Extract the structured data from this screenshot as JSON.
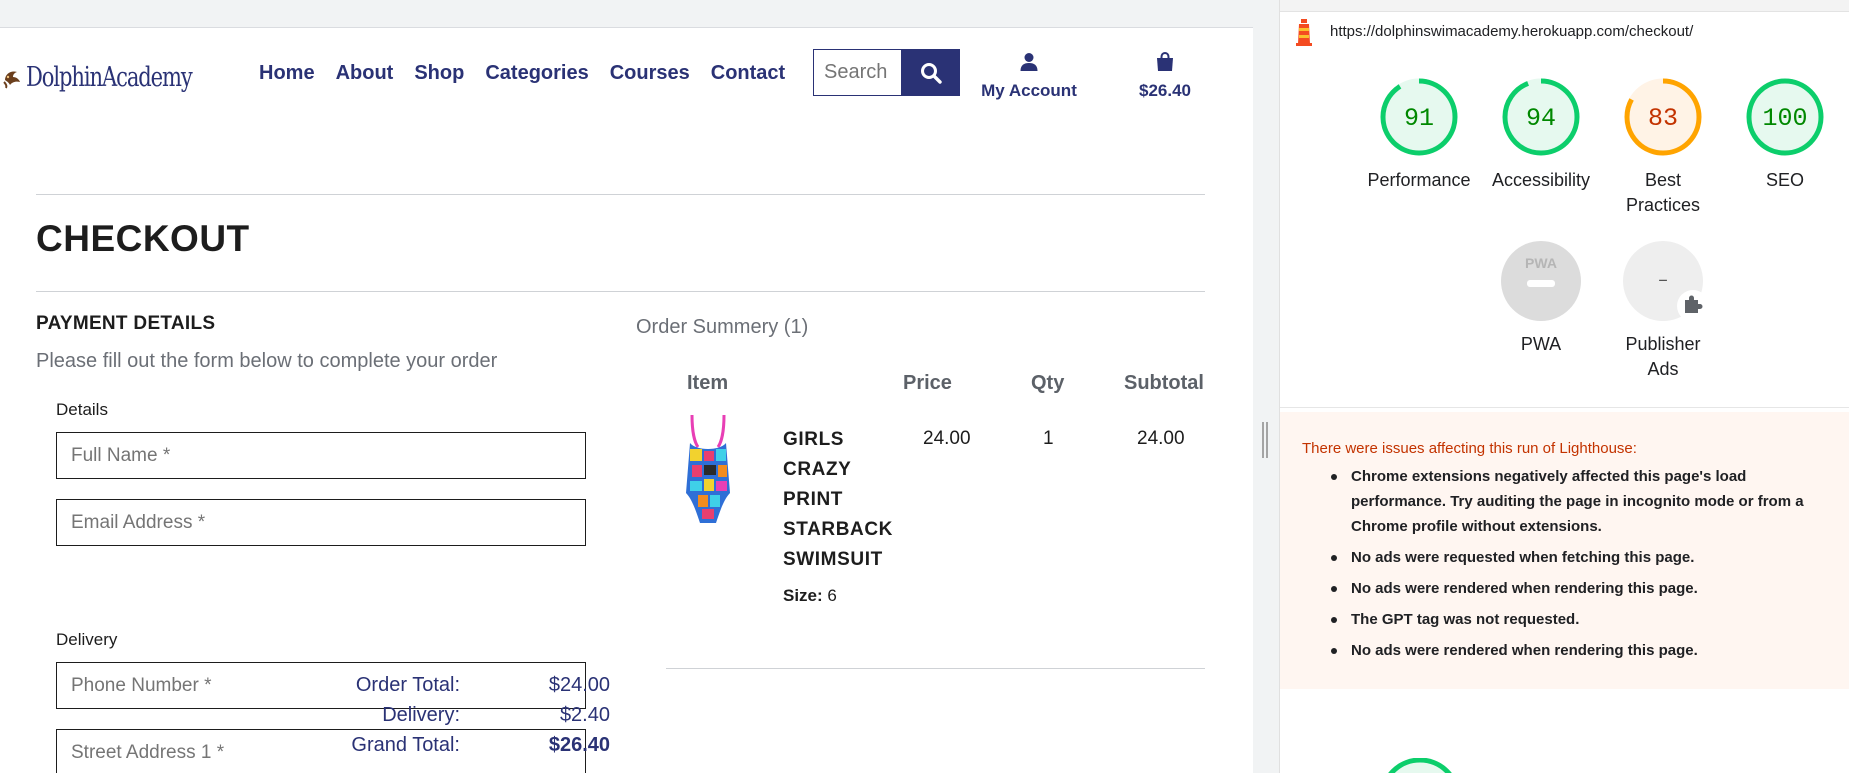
{
  "site": {
    "logo_text": "DolphinAcademy",
    "nav": [
      "Home",
      "About",
      "Shop",
      "Categories",
      "Courses",
      "Contact"
    ],
    "search_placeholder": "Search",
    "account_label": "My Account",
    "bag_total": "$26.40"
  },
  "checkout": {
    "title": "CHECKOUT",
    "payment_title": "PAYMENT DETAILS",
    "payment_subtitle": "Please fill out the form below to complete your order",
    "details_label": "Details",
    "full_name_placeholder": "Full Name *",
    "email_placeholder": "Email Address *",
    "delivery_label": "Delivery",
    "phone_placeholder": "Phone Number *",
    "street1_placeholder": "Street Address 1 *"
  },
  "summary": {
    "title": "Order Summery (1)",
    "headers": {
      "item": "Item",
      "price": "Price",
      "qty": "Qty",
      "subtotal": "Subtotal"
    },
    "product": {
      "name_lines": [
        "GIRLS",
        "CRAZY",
        "PRINT",
        "STARBACK",
        "SWIMSUIT"
      ],
      "size_label": "Size:",
      "size_value": "6",
      "price": "24.00",
      "qty": "1",
      "subtotal": "24.00"
    },
    "totals": {
      "order_total_label": "Order Total:",
      "order_total_value": "$24.00",
      "delivery_label": "Delivery:",
      "delivery_value": "$2.40",
      "grand_total_label": "Grand Total:",
      "grand_total_value": "$26.40"
    }
  },
  "lighthouse": {
    "url": "https://dolphinswimacademy.herokuapp.com/checkout/",
    "scores": [
      {
        "value": "91",
        "score": 91,
        "label": "Performance",
        "status": "pass"
      },
      {
        "value": "94",
        "score": 94,
        "label": "Accessibility",
        "status": "pass"
      },
      {
        "value": "83",
        "score": 83,
        "label": "Best Practices",
        "status": "average"
      },
      {
        "value": "100",
        "score": 100,
        "label": "SEO",
        "status": "pass"
      }
    ],
    "pwa": {
      "badge": "PWA",
      "label": "PWA"
    },
    "publisher_ads": {
      "value": "–",
      "label": "Publisher Ads"
    },
    "warning_title": "There were issues affecting this run of Lighthouse:",
    "warnings": [
      "Chrome extensions negatively affected this page's load performance. Try auditing the page in incognito mode or from a Chrome profile without extensions.",
      "No ads were requested when fetching this page.",
      "No ads were rendered when rendering this page.",
      "The GPT tag was not requested.",
      "No ads were rendered when rendering this page."
    ],
    "colors": {
      "pass": "#0cce6b",
      "pass_text": "#008800",
      "pass_bg": "#e6f9ef",
      "average": "#ffa400",
      "average_text": "#c33300",
      "average_bg": "#fff3e6",
      "na": "#cfcfcf"
    }
  }
}
